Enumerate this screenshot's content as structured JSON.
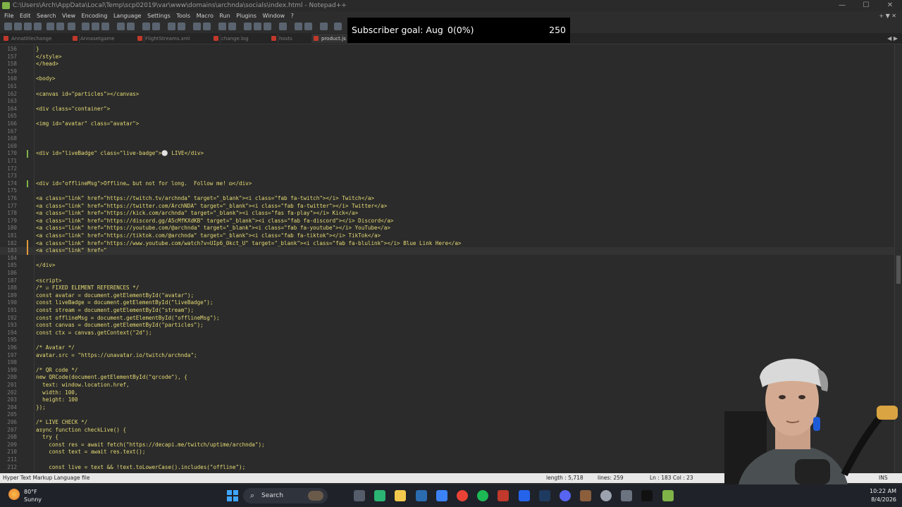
{
  "window": {
    "title": "C:\\Users\\Arch\\AppData\\Local\\Temp\\scp02019\\var\\www\\domains\\archnda\\socials\\index.html - Notepad++",
    "minimize": "—",
    "maximize": "☐",
    "close": "✕"
  },
  "menu": [
    "File",
    "Edit",
    "Search",
    "View",
    "Encoding",
    "Language",
    "Settings",
    "Tools",
    "Macro",
    "Run",
    "Plugins",
    "Window",
    "?"
  ],
  "menu_right": "+ ▼ ✕",
  "tabs": [
    "Annatitlechange",
    "Annasetgame",
    "FlightStreams.xml",
    "change.log",
    "hosts",
    "product.js"
  ],
  "tab_nav": "◀ ▶",
  "overlay": {
    "label": "Subscriber goal: Aug",
    "progress": "0(0%)",
    "goal": "250"
  },
  "code": [
    {
      "n": "156",
      "t": "}"
    },
    {
      "n": "157",
      "t": "</style>"
    },
    {
      "n": "158",
      "t": "</head>"
    },
    {
      "n": "159",
      "t": ""
    },
    {
      "n": "160",
      "t": "<body>"
    },
    {
      "n": "161",
      "t": ""
    },
    {
      "n": "162",
      "t": "<canvas id=\"particles\"></canvas>"
    },
    {
      "n": "163",
      "t": ""
    },
    {
      "n": "164",
      "t": "<div class=\"container\">"
    },
    {
      "n": "165",
      "t": ""
    },
    {
      "n": "166",
      "t": "<img id=\"avatar\" class=\"avatar\">"
    },
    {
      "n": "167",
      "t": ""
    },
    {
      "n": "168",
      "t": ""
    },
    {
      "n": "169",
      "t": ""
    },
    {
      "n": "170",
      "t": "<div id=\"liveBadge\" class=\"live-badge\">⚪ LIVE</div>"
    },
    {
      "n": "171",
      "t": ""
    },
    {
      "n": "172",
      "t": ""
    },
    {
      "n": "173",
      "t": ""
    },
    {
      "n": "174",
      "t": "<div id=\"offlineMsg\">Offline… but not for long.  Follow me! ⚃</div>"
    },
    {
      "n": "175",
      "t": ""
    },
    {
      "n": "176",
      "t": "<a class=\"link\" href=\"https://twitch.tv/archnda\" target=\"_blank\"><i class=\"fab fa-twitch\"></i> Twitch</a>"
    },
    {
      "n": "177",
      "t": "<a class=\"link\" href=\"https://twitter.com/ArchNDA\" target=\"_blank\"><i class=\"fab fa-twitter\"></i> Twitter</a>"
    },
    {
      "n": "178",
      "t": "<a class=\"link\" href=\"https://kick.com/archnda\" target=\"_blank\"><i class=\"fas fa-play\"></i> Kick</a>"
    },
    {
      "n": "179",
      "t": "<a class=\"link\" href=\"https://discord.gg/A5cMfKXdKB\" target=\"_blank\"><i class=\"fab fa-discord\"></i> Discord</a>"
    },
    {
      "n": "180",
      "t": "<a class=\"link\" href=\"https://youtube.com/@archnda\" target=\"_blank\"><i class=\"fab fa-youtube\"></i> YouTube</a>"
    },
    {
      "n": "181",
      "t": "<a class=\"link\" href=\"https://tiktok.com/@archnda\" target=\"_blank\"><i class=\"fab fa-tiktok\"></i> TikTok</a>"
    },
    {
      "n": "182",
      "t": "<a class=\"link\" href=\"https://www.youtube.com/watch?v=UIp6_0kct_U\" target=\"_blank\"><i class=\"fab fa-blulink\"></i> Blue Link Here</a>"
    },
    {
      "n": "183",
      "t": "<a class=\"link\" href=\""
    },
    {
      "n": "184",
      "t": ""
    },
    {
      "n": "185",
      "t": "</div>"
    },
    {
      "n": "186",
      "t": ""
    },
    {
      "n": "187",
      "t": "<script>"
    },
    {
      "n": "188",
      "t": "/* ☑ FIXED ELEMENT REFERENCES */"
    },
    {
      "n": "189",
      "t": "const avatar = document.getElementById(\"avatar\");"
    },
    {
      "n": "190",
      "t": "const liveBadge = document.getElementById(\"liveBadge\");"
    },
    {
      "n": "191",
      "t": "const stream = document.getElementById(\"stream\");"
    },
    {
      "n": "192",
      "t": "const offlineMsg = document.getElementById(\"offlineMsg\");"
    },
    {
      "n": "193",
      "t": "const canvas = document.getElementById(\"particles\");"
    },
    {
      "n": "194",
      "t": "const ctx = canvas.getContext(\"2d\");"
    },
    {
      "n": "195",
      "t": ""
    },
    {
      "n": "196",
      "t": "/* Avatar */"
    },
    {
      "n": "197",
      "t": "avatar.src = \"https://unavatar.io/twitch/archnda\";"
    },
    {
      "n": "198",
      "t": ""
    },
    {
      "n": "199",
      "t": "/* QR code */"
    },
    {
      "n": "200",
      "t": "new QRCode(document.getElementById(\"qrcode\"), {"
    },
    {
      "n": "201",
      "t": "  text: window.location.href,"
    },
    {
      "n": "202",
      "t": "  width: 100,"
    },
    {
      "n": "203",
      "t": "  height: 100"
    },
    {
      "n": "204",
      "t": "});"
    },
    {
      "n": "205",
      "t": ""
    },
    {
      "n": "206",
      "t": "/* LIVE CHECK */"
    },
    {
      "n": "207",
      "t": "async function checkLive() {"
    },
    {
      "n": "208",
      "t": "  try {"
    },
    {
      "n": "209",
      "t": "    const res = await fetch(\"https://decapi.me/twitch/uptime/archnda\");"
    },
    {
      "n": "210",
      "t": "    const text = await res.text();"
    },
    {
      "n": "211",
      "t": ""
    },
    {
      "n": "212",
      "t": "    const live = text && !text.toLowerCase().includes(\"offline\");"
    }
  ],
  "status": {
    "filetype": "Hyper Text Markup Language file",
    "length": "length : 5,718",
    "lines": "lines: 259",
    "pos": "Ln : 183   Col : 23",
    "mode": "INS"
  },
  "taskbar": {
    "temp": "80°F",
    "condition": "Sunny",
    "search": "Search",
    "time": "10:22 AM",
    "date": "8/4/2026"
  }
}
